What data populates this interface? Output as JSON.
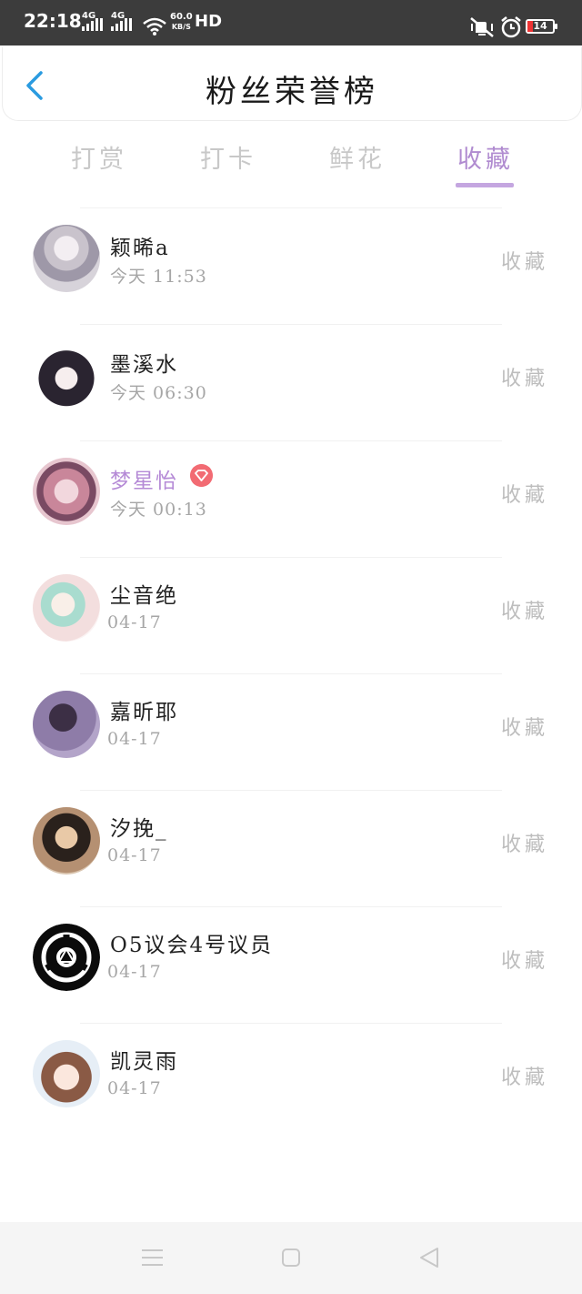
{
  "status": {
    "time": "22:18",
    "network_1": "4G",
    "network_2": "4G",
    "speed_value": "60.0",
    "speed_unit": "KB/S",
    "hd_label": "HD",
    "battery": "14"
  },
  "header": {
    "title": "粉丝荣誉榜"
  },
  "tabs": [
    {
      "label": "打赏",
      "active": false
    },
    {
      "label": "打卡",
      "active": false
    },
    {
      "label": "鲜花",
      "active": false
    },
    {
      "label": "收藏",
      "active": true
    }
  ],
  "colors": {
    "accent": "#b08bd0",
    "vip_badge": "#f26b73",
    "back_arrow": "#2a9be0"
  },
  "fans": [
    {
      "name": "颖晞a",
      "time": "今天 11:53",
      "action": "收藏",
      "vip": false
    },
    {
      "name": "墨溪水",
      "time": "今天 06:30",
      "action": "收藏",
      "vip": false
    },
    {
      "name": "梦星怡",
      "time": "今天 00:13",
      "action": "收藏",
      "vip": true
    },
    {
      "name": "尘音绝",
      "time": "04-17",
      "action": "收藏",
      "vip": false
    },
    {
      "name": "嘉昕耶",
      "time": "04-17",
      "action": "收藏",
      "vip": false
    },
    {
      "name": "汐挽_",
      "time": "04-17",
      "action": "收藏",
      "vip": false
    },
    {
      "name": "O5议会4号议员",
      "time": "04-17",
      "action": "收藏",
      "vip": false
    },
    {
      "name": "凯灵雨",
      "time": "04-17",
      "action": "收藏",
      "vip": false
    }
  ],
  "nav": {
    "icons": [
      "menu-icon",
      "home-square-icon",
      "back-triangle-icon"
    ]
  }
}
